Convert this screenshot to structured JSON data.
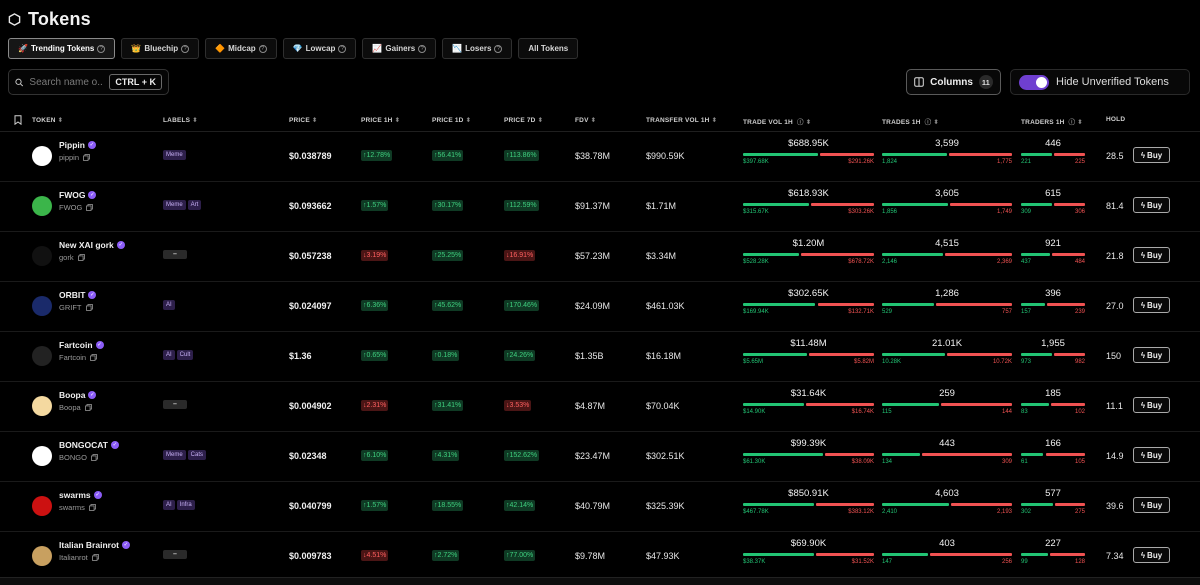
{
  "header": {
    "title": "Tokens"
  },
  "tabs": [
    {
      "label": "Trending Tokens",
      "emoji": "🚀",
      "help": true,
      "active": true
    },
    {
      "label": "Bluechip",
      "emoji": "👑",
      "help": true,
      "active": false
    },
    {
      "label": "Midcap",
      "emoji": "🔶",
      "help": true,
      "active": false
    },
    {
      "label": "Lowcap",
      "emoji": "💎",
      "help": true,
      "active": false
    },
    {
      "label": "Gainers",
      "emoji": "📈",
      "help": true,
      "active": false
    },
    {
      "label": "Losers",
      "emoji": "📉",
      "help": true,
      "active": false
    },
    {
      "label": "All Tokens",
      "emoji": "",
      "help": false,
      "active": false
    }
  ],
  "search": {
    "placeholder": "Search name o...",
    "shortcut": "CTRL + K"
  },
  "columns_button": {
    "label": "Columns",
    "count": "11"
  },
  "unverified_toggle": {
    "label": "Hide Unverified Tokens",
    "on": true
  },
  "columns": [
    {
      "label": "TOKEN",
      "sort": true,
      "help": false
    },
    {
      "label": "LABELS",
      "sort": true,
      "help": false
    },
    {
      "label": "PRICE",
      "sort": true,
      "help": false
    },
    {
      "label": "PRICE 1H",
      "sort": true,
      "help": false
    },
    {
      "label": "PRICE 1D",
      "sort": true,
      "help": false
    },
    {
      "label": "PRICE 7D",
      "sort": true,
      "help": false
    },
    {
      "label": "FDV",
      "sort": true,
      "help": false
    },
    {
      "label": "TRANSFER VOL 1H",
      "sort": true,
      "help": false
    },
    {
      "label": "TRADE VOL 1H",
      "sort": true,
      "help": true
    },
    {
      "label": "TRADES 1H",
      "sort": true,
      "help": true
    },
    {
      "label": "TRADERS 1H",
      "sort": true,
      "help": true
    },
    {
      "label": "HOLD",
      "sort": false,
      "help": false
    }
  ],
  "buy_label": "Buy",
  "rows": [
    {
      "name": "Pippin",
      "symbol": "pippin",
      "avatar_color": "#ffffff",
      "labels": [
        "Meme"
      ],
      "price": "$0.038789",
      "p1h": "↑12.78%",
      "p1h_dir": "up",
      "p1d": "↑56.41%",
      "p1d_dir": "up",
      "p7d": "↑113.86%",
      "p7d_dir": "up",
      "fdv": "$38.78M",
      "transfer_vol": "$990.59K",
      "trade_vol": {
        "total": "$688.95K",
        "buy": "$397.68K",
        "sell": "$291.26K",
        "buy_frac": 0.577
      },
      "trades": {
        "total": "3,599",
        "buy": "1,824",
        "sell": "1,775",
        "buy_frac": 0.507
      },
      "traders": {
        "total": "446",
        "buy": "221",
        "sell": "225",
        "buy_frac": 0.496
      },
      "holders": "28.5"
    },
    {
      "name": "FWOG",
      "symbol": "FWOG",
      "avatar_color": "#3bb54a",
      "labels": [
        "Meme",
        "Art"
      ],
      "price": "$0.093662",
      "p1h": "↑1.57%",
      "p1h_dir": "up",
      "p1d": "↑30.17%",
      "p1d_dir": "up",
      "p7d": "↑112.59%",
      "p7d_dir": "up",
      "fdv": "$91.37M",
      "transfer_vol": "$1.71M",
      "trade_vol": {
        "total": "$618.93K",
        "buy": "$315.67K",
        "sell": "$303.26K",
        "buy_frac": 0.51
      },
      "trades": {
        "total": "3,605",
        "buy": "1,856",
        "sell": "1,749",
        "buy_frac": 0.515
      },
      "traders": {
        "total": "615",
        "buy": "309",
        "sell": "306",
        "buy_frac": 0.502
      },
      "holders": "81.4"
    },
    {
      "name": "New XAI gork",
      "symbol": "gork",
      "avatar_color": "#111111",
      "labels": [],
      "price": "$0.057238",
      "p1h": "↓3.19%",
      "p1h_dir": "down",
      "p1d": "↑25.25%",
      "p1d_dir": "up",
      "p7d": "↓16.91%",
      "p7d_dir": "down",
      "fdv": "$57.23M",
      "transfer_vol": "$3.34M",
      "trade_vol": {
        "total": "$1.20M",
        "buy": "$528.28K",
        "sell": "$678.72K",
        "buy_frac": 0.438
      },
      "trades": {
        "total": "4,515",
        "buy": "2,146",
        "sell": "2,369",
        "buy_frac": 0.475
      },
      "traders": {
        "total": "921",
        "buy": "437",
        "sell": "484",
        "buy_frac": 0.474
      },
      "holders": "21.8"
    },
    {
      "name": "ORBIT",
      "symbol": "GRIFT",
      "avatar_color": "#1a2a6a",
      "labels": [
        "AI"
      ],
      "price": "$0.024097",
      "p1h": "↑6.36%",
      "p1h_dir": "up",
      "p1d": "↑45.62%",
      "p1d_dir": "up",
      "p7d": "↑170.46%",
      "p7d_dir": "up",
      "fdv": "$24.09M",
      "transfer_vol": "$461.03K",
      "trade_vol": {
        "total": "$302.65K",
        "buy": "$169.94K",
        "sell": "$132.71K",
        "buy_frac": 0.561
      },
      "trades": {
        "total": "1,286",
        "buy": "529",
        "sell": "757",
        "buy_frac": 0.411
      },
      "traders": {
        "total": "396",
        "buy": "157",
        "sell": "239",
        "buy_frac": 0.396
      },
      "holders": "27.0"
    },
    {
      "name": "Fartcoin",
      "symbol": "Fartcoin",
      "avatar_color": "#222222",
      "labels": [
        "AI",
        "Cult"
      ],
      "price": "$1.36",
      "p1h": "↑0.65%",
      "p1h_dir": "up",
      "p1d": "↑0.18%",
      "p1d_dir": "up",
      "p7d": "↑24.26%",
      "p7d_dir": "up",
      "fdv": "$1.35B",
      "transfer_vol": "$16.18M",
      "trade_vol": {
        "total": "$11.48M",
        "buy": "$5.65M",
        "sell": "$5.82M",
        "buy_frac": 0.493
      },
      "trades": {
        "total": "21.01K",
        "buy": "10.28K",
        "sell": "10.72K",
        "buy_frac": 0.49
      },
      "traders": {
        "total": "1,955",
        "buy": "973",
        "sell": "982",
        "buy_frac": 0.498
      },
      "holders": "150"
    },
    {
      "name": "Boopa",
      "symbol": "Boopa",
      "avatar_color": "#f4d9a0",
      "labels": [],
      "price": "$0.004902",
      "p1h": "↓2.31%",
      "p1h_dir": "down",
      "p1d": "↑31.41%",
      "p1d_dir": "up",
      "p7d": "↓3.53%",
      "p7d_dir": "down",
      "fdv": "$4.87M",
      "transfer_vol": "$70.04K",
      "trade_vol": {
        "total": "$31.64K",
        "buy": "$14.90K",
        "sell": "$16.74K",
        "buy_frac": 0.471
      },
      "trades": {
        "total": "259",
        "buy": "115",
        "sell": "144",
        "buy_frac": 0.444
      },
      "traders": {
        "total": "185",
        "buy": "83",
        "sell": "102",
        "buy_frac": 0.449
      },
      "holders": "11.1"
    },
    {
      "name": "BONGOCAT",
      "symbol": "BONGO",
      "avatar_color": "#ffffff",
      "labels": [
        "Meme",
        "Cats"
      ],
      "price": "$0.02348",
      "p1h": "↑6.10%",
      "p1h_dir": "up",
      "p1d": "↑4.31%",
      "p1d_dir": "up",
      "p7d": "↑152.62%",
      "p7d_dir": "up",
      "fdv": "$23.47M",
      "transfer_vol": "$302.51K",
      "trade_vol": {
        "total": "$99.39K",
        "buy": "$61.30K",
        "sell": "$38.09K",
        "buy_frac": 0.617
      },
      "trades": {
        "total": "443",
        "buy": "134",
        "sell": "309",
        "buy_frac": 0.302
      },
      "traders": {
        "total": "166",
        "buy": "61",
        "sell": "105",
        "buy_frac": 0.367
      },
      "holders": "14.9"
    },
    {
      "name": "swarms",
      "symbol": "swarms",
      "avatar_color": "#cc1111",
      "labels": [
        "AI",
        "Infra"
      ],
      "price": "$0.040799",
      "p1h": "↑1.57%",
      "p1h_dir": "up",
      "p1d": "↑18.55%",
      "p1d_dir": "up",
      "p7d": "↑42.14%",
      "p7d_dir": "up",
      "fdv": "$40.79M",
      "transfer_vol": "$325.39K",
      "trade_vol": {
        "total": "$850.91K",
        "buy": "$467.78K",
        "sell": "$383.12K",
        "buy_frac": 0.55
      },
      "trades": {
        "total": "4,603",
        "buy": "2,410",
        "sell": "2,193",
        "buy_frac": 0.524
      },
      "traders": {
        "total": "577",
        "buy": "302",
        "sell": "275",
        "buy_frac": 0.523
      },
      "holders": "39.6"
    },
    {
      "name": "Italian Brainrot",
      "symbol": "Italianrot",
      "avatar_color": "#c8a060",
      "labels": [],
      "price": "$0.009783",
      "p1h": "↓4.51%",
      "p1h_dir": "down",
      "p1d": "↑2.72%",
      "p1d_dir": "up",
      "p7d": "↑77.00%",
      "p7d_dir": "up",
      "fdv": "$9.78M",
      "transfer_vol": "$47.93K",
      "trade_vol": {
        "total": "$69.90K",
        "buy": "$38.37K",
        "sell": "$31.52K",
        "buy_frac": 0.549
      },
      "trades": {
        "total": "403",
        "buy": "147",
        "sell": "256",
        "buy_frac": 0.365
      },
      "traders": {
        "total": "227",
        "buy": "99",
        "sell": "128",
        "buy_frac": 0.436
      },
      "holders": "7.34"
    }
  ],
  "empty_label": "–",
  "colors": {
    "accent": "#6f3fd0",
    "up": "#22c474",
    "down": "#f05252",
    "verified": "#8b5cf6"
  }
}
